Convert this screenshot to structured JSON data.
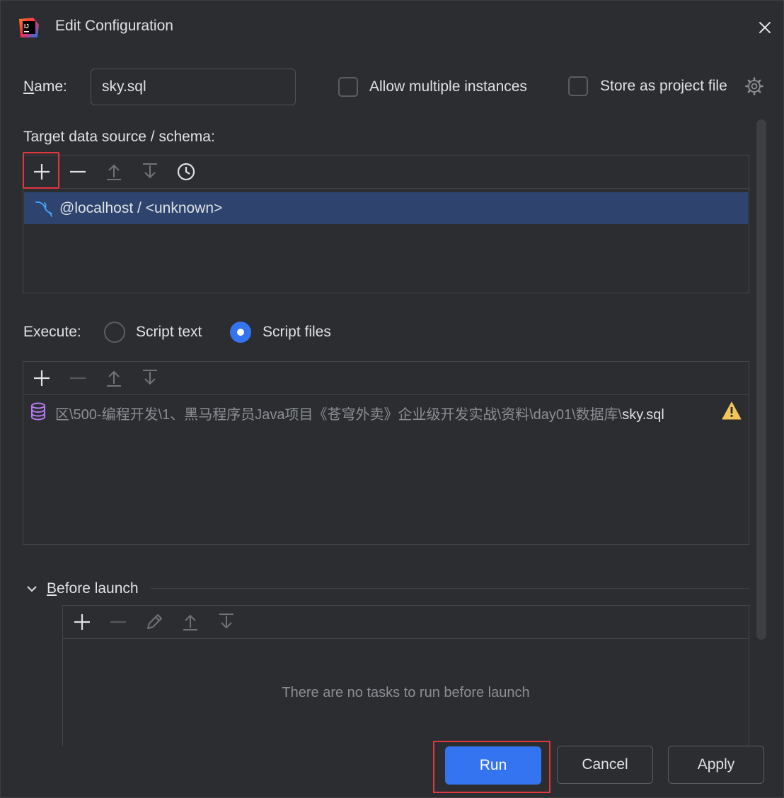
{
  "window": {
    "title": "Edit Configuration"
  },
  "name_field": {
    "label": "Name:",
    "value": "sky.sql"
  },
  "options": {
    "allow_multiple_instances": {
      "label": "Allow multiple instances",
      "checked": false
    },
    "store_as_project_file": {
      "label": "Store as project file",
      "checked": false
    }
  },
  "target": {
    "label": "Target data source / schema:",
    "items": [
      {
        "label": "@localhost / <unknown>",
        "icon": "mysql-dolphin-icon",
        "selected": true
      }
    ]
  },
  "execute": {
    "label": "Execute:",
    "options": [
      {
        "label": "Script text",
        "selected": false
      },
      {
        "label": "Script files",
        "selected": true
      }
    ],
    "files": [
      {
        "path_prefix": "区\\500-编程开发\\1、黑马程序员Java项目《苍穹外卖》企业级开发实战\\资料\\day01\\数据库\\",
        "filename": "sky.sql",
        "icon": "database-icon",
        "warning": true
      }
    ]
  },
  "before_launch": {
    "label": "Before launch",
    "expanded": true,
    "empty_text": "There are no tasks to run before launch"
  },
  "buttons": {
    "run": "Run",
    "cancel": "Cancel",
    "apply": "Apply"
  },
  "colors": {
    "accent": "#3574f0",
    "highlight_border": "#e0383e",
    "selection": "#2e436e",
    "background": "#2b2d30"
  }
}
